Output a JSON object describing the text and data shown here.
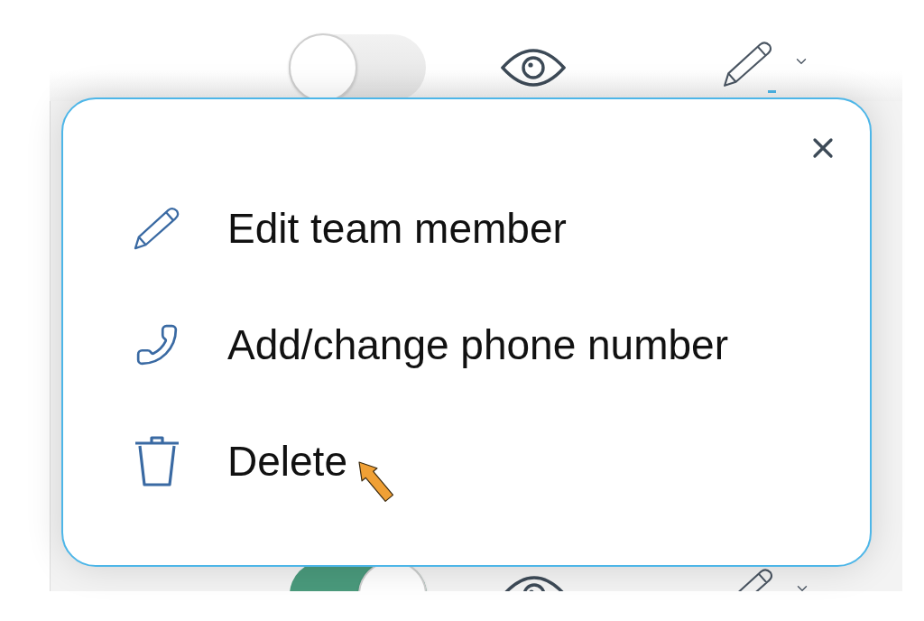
{
  "rows": [
    {
      "switch_on": false,
      "edit_menu_open": true
    },
    {
      "switch_on": true,
      "edit_menu_open": false
    }
  ],
  "menu": {
    "items": [
      {
        "kind": "edit",
        "label": "Edit team member",
        "pointed_at": false
      },
      {
        "kind": "phone",
        "label": "Add/change phone number",
        "pointed_at": false
      },
      {
        "kind": "delete",
        "label": "Delete",
        "pointed_at": true
      }
    ]
  }
}
